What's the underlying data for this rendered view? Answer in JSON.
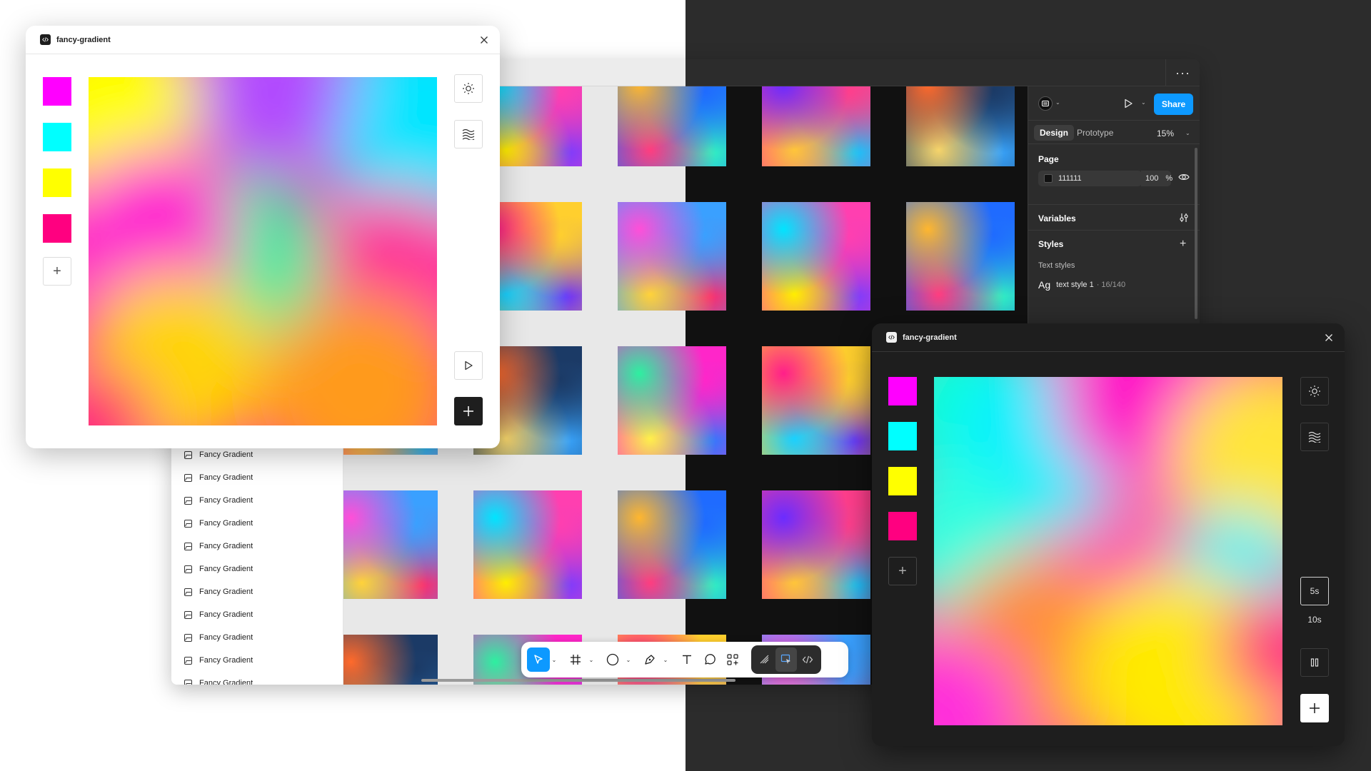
{
  "main_window": {
    "more_label": "···"
  },
  "layers": {
    "items": [
      {
        "label": "Fancy Gradient"
      },
      {
        "label": "Fancy Gradient"
      },
      {
        "label": "Fancy Gradient"
      },
      {
        "label": "Fancy Gradient"
      },
      {
        "label": "Fancy Gradient"
      },
      {
        "label": "Fancy Gradient"
      },
      {
        "label": "Fancy Gradient"
      },
      {
        "label": "Fancy Gradient"
      },
      {
        "label": "Fancy Gradient"
      },
      {
        "label": "Fancy Gradient"
      },
      {
        "label": "Fancy Gradient"
      }
    ]
  },
  "design_panel": {
    "share_label": "Share",
    "tabs": [
      {
        "label": "Design"
      },
      {
        "label": "Prototype"
      }
    ],
    "zoom": "15%",
    "page": {
      "title": "Page",
      "color_hex": "111111",
      "opacity": "100",
      "opacity_unit": "%"
    },
    "variables_title": "Variables",
    "styles": {
      "title": "Styles",
      "text_styles_label": "Text styles",
      "glyph": "Ag",
      "style_name": "text style 1",
      "style_meta": "· 16/140"
    }
  },
  "toolbar": {
    "tools": [
      "move-tool",
      "frame-tool",
      "shape-tool",
      "pen-tool",
      "text-tool",
      "comment-tool",
      "actions-tool"
    ],
    "dev_tools": [
      "draw-mode",
      "design-mode",
      "dev-mode"
    ]
  },
  "plugin_light": {
    "title": "fancy-gradient",
    "swatches": [
      "#ff00ff",
      "#00ffff",
      "#ffff00",
      "#ff0080"
    ],
    "add_label": "+"
  },
  "plugin_dark": {
    "title": "fancy-gradient",
    "swatches": [
      "#ff00ff",
      "#00ffff",
      "#ffff00",
      "#ff0080"
    ],
    "add_label": "+",
    "durations": [
      {
        "label": "5s",
        "selected": true
      },
      {
        "label": "10s",
        "selected": false
      }
    ]
  },
  "colors": {
    "accent": "#0d99ff",
    "dark_bg": "#2c2c2c",
    "canvas_dark": "#111111",
    "canvas_light": "#e8e8e8"
  }
}
